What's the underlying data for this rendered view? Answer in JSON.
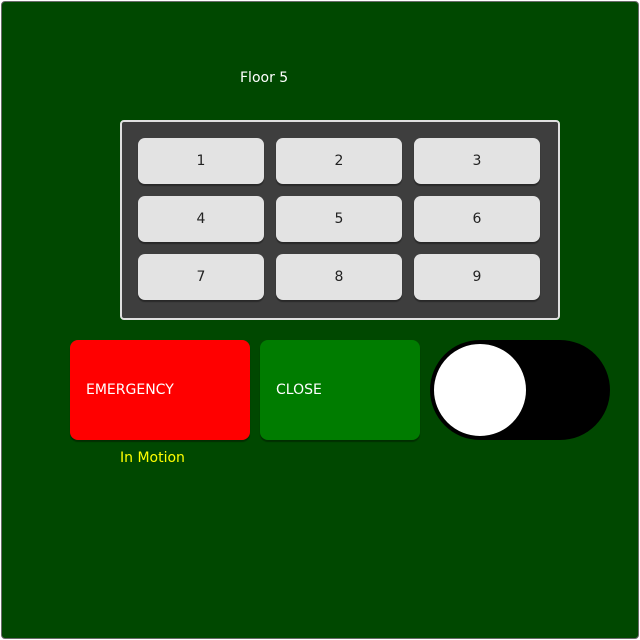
{
  "floor_display": "Floor 5",
  "keypad": {
    "keys": [
      "1",
      "2",
      "3",
      "4",
      "5",
      "6",
      "7",
      "8",
      "9"
    ]
  },
  "emergency_button": {
    "label": "EMERGENCY",
    "color": "#ff0000"
  },
  "close_button": {
    "label": "CLOSE",
    "color": "#007c00"
  },
  "toggle": {
    "state": "off"
  },
  "status_text": "In Motion",
  "colors": {
    "background": "#004800",
    "keypad_panel": "#3e3e3e",
    "key": "#e3e3e3",
    "status": "#ffff00"
  }
}
